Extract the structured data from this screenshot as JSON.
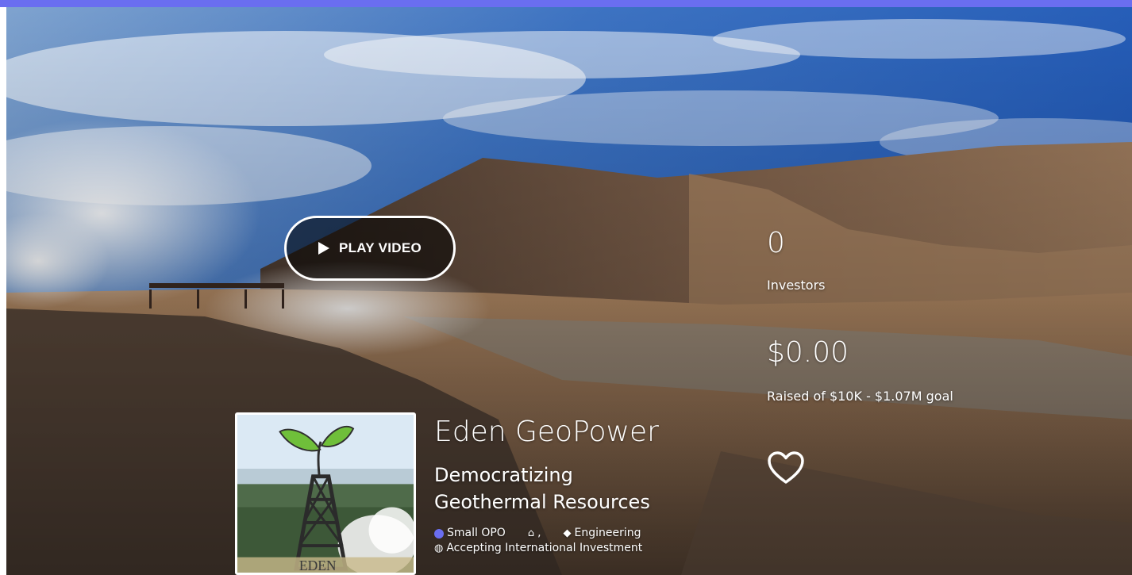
{
  "hero": {
    "play_label": "PLAY VIDEO"
  },
  "stats": {
    "investors_count": "0",
    "investors_label": "Investors",
    "raised_amount": "$0.00",
    "raised_label": "Raised of $10K - $1.07M goal"
  },
  "company": {
    "name": "Eden GeoPower",
    "tagline_line1": "Democratizing",
    "tagline_line2": "Geothermal Resources",
    "logo_text": "EDEN"
  },
  "meta": {
    "offering_type": "Small OPO",
    "location_suffix": ",",
    "category": "Engineering",
    "international": "Accepting International Investment"
  },
  "colors": {
    "accent": "#6a6ef0"
  },
  "icons": {
    "play": "play-icon",
    "favorite": "heart-icon",
    "offering": "dot-icon",
    "location": "home-icon",
    "category": "tag-icon",
    "international": "globe-icon"
  }
}
